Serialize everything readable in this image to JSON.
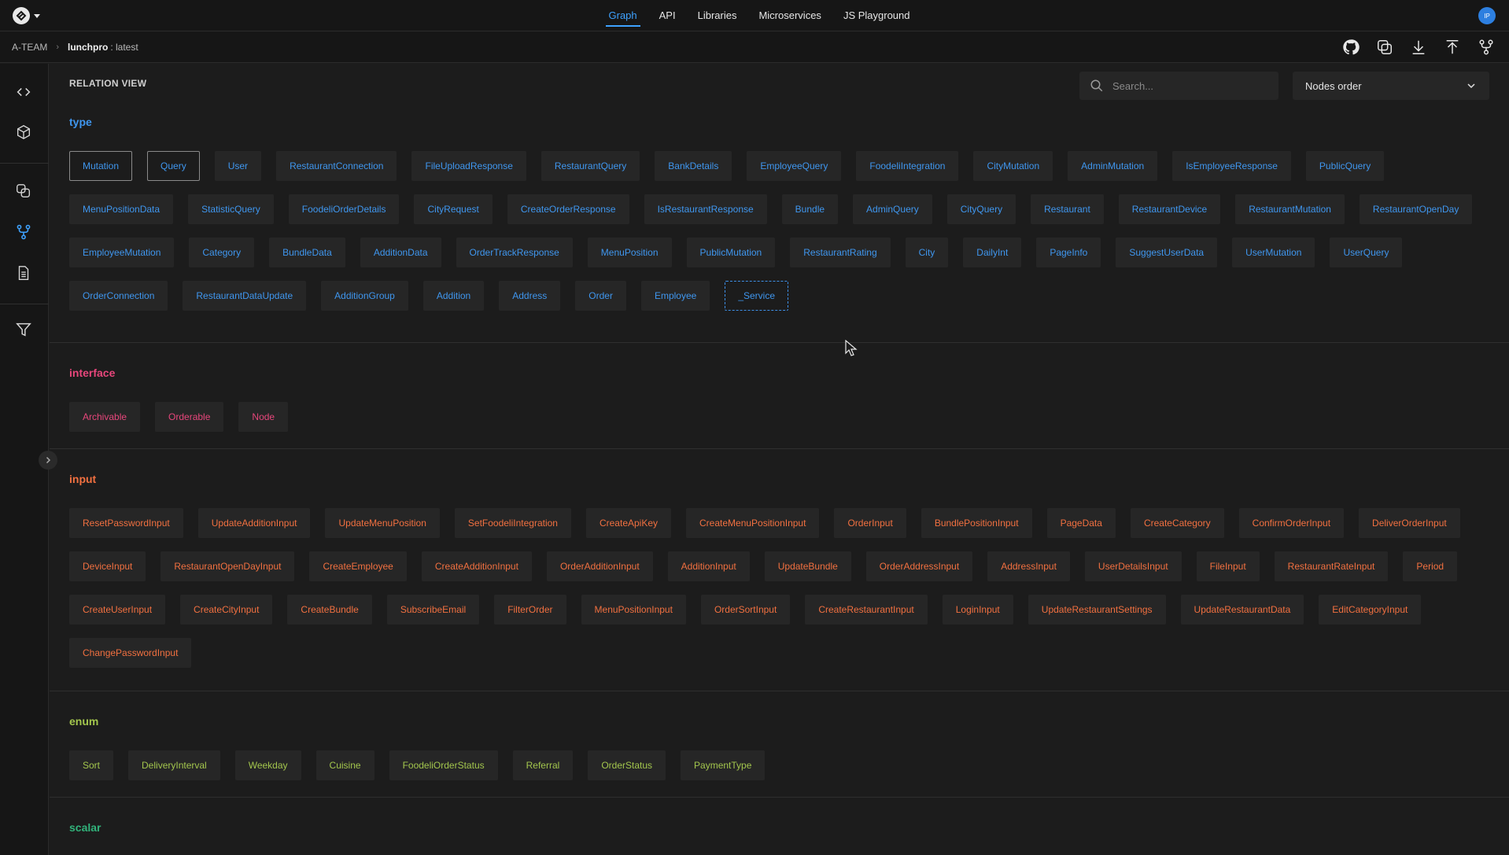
{
  "top_nav": {
    "items": [
      {
        "label": "Graph",
        "active": true
      },
      {
        "label": "API",
        "active": false
      },
      {
        "label": "Libraries",
        "active": false
      },
      {
        "label": "Microservices",
        "active": false
      },
      {
        "label": "JS Playground",
        "active": false
      }
    ],
    "user_initials": "IP"
  },
  "breadcrumb": {
    "team": "A-TEAM",
    "project": "lunchpro",
    "version": ": latest"
  },
  "toolbar_icons": [
    "github-icon",
    "copy-icon",
    "download-icon",
    "upload-icon",
    "fork-icon"
  ],
  "rail_icons": [
    "code-icon",
    "cube-icon",
    "layers-icon",
    "relation-icon",
    "document-icon",
    "filter-icon"
  ],
  "relation_view": {
    "title": "RELATION VIEW",
    "search_placeholder": "Search...",
    "order_select": "Nodes order"
  },
  "sections": {
    "type": {
      "heading": "type",
      "items": [
        "Mutation",
        "Query",
        "User",
        "RestaurantConnection",
        "FileUploadResponse",
        "RestaurantQuery",
        "BankDetails",
        "EmployeeQuery",
        "FoodeliIntegration",
        "CityMutation",
        "AdminMutation",
        "IsEmployeeResponse",
        "PublicQuery",
        "MenuPositionData",
        "StatisticQuery",
        "FoodeliOrderDetails",
        "CityRequest",
        "CreateOrderResponse",
        "IsRestaurantResponse",
        "Bundle",
        "AdminQuery",
        "CityQuery",
        "Restaurant",
        "RestaurantDevice",
        "RestaurantMutation",
        "RestaurantOpenDay",
        "EmployeeMutation",
        "Category",
        "BundleData",
        "AdditionData",
        "OrderTrackResponse",
        "MenuPosition",
        "PublicMutation",
        "RestaurantRating",
        "City",
        "DailyInt",
        "PageInfo",
        "SuggestUserData",
        "UserMutation",
        "UserQuery",
        "OrderConnection",
        "RestaurantDataUpdate",
        "AdditionGroup",
        "Addition",
        "Address",
        "Order",
        "Employee",
        "_Service"
      ],
      "selected": [
        "Mutation",
        "Query"
      ],
      "dashed": [
        "_Service"
      ]
    },
    "interface": {
      "heading": "interface",
      "items": [
        "Archivable",
        "Orderable",
        "Node"
      ]
    },
    "input": {
      "heading": "input",
      "items": [
        "ResetPasswordInput",
        "UpdateAdditionInput",
        "UpdateMenuPosition",
        "SetFoodeliIntegration",
        "CreateApiKey",
        "CreateMenuPositionInput",
        "OrderInput",
        "BundlePositionInput",
        "PageData",
        "CreateCategory",
        "ConfirmOrderInput",
        "DeliverOrderInput",
        "DeviceInput",
        "RestaurantOpenDayInput",
        "CreateEmployee",
        "CreateAdditionInput",
        "OrderAdditionInput",
        "AdditionInput",
        "UpdateBundle",
        "OrderAddressInput",
        "AddressInput",
        "UserDetailsInput",
        "FileInput",
        "RestaurantRateInput",
        "Period",
        "CreateUserInput",
        "CreateCityInput",
        "CreateBundle",
        "SubscribeEmail",
        "FilterOrder",
        "MenuPositionInput",
        "OrderSortInput",
        "CreateRestaurantInput",
        "LoginInput",
        "UpdateRestaurantSettings",
        "UpdateRestaurantData",
        "EditCategoryInput",
        "ChangePasswordInput"
      ]
    },
    "enum": {
      "heading": "enum",
      "items": [
        "Sort",
        "DeliveryInterval",
        "Weekday",
        "Cuisine",
        "FoodeliOrderStatus",
        "Referral",
        "OrderStatus",
        "PaymentType"
      ]
    },
    "scalar": {
      "heading": "scalar",
      "items": []
    }
  },
  "colors": {
    "type": "#3f96ee",
    "interface": "#e7467b",
    "input": "#f17040",
    "enum": "#a3c64d",
    "scalar": "#31b27a",
    "accent": "#3ea2ff"
  }
}
